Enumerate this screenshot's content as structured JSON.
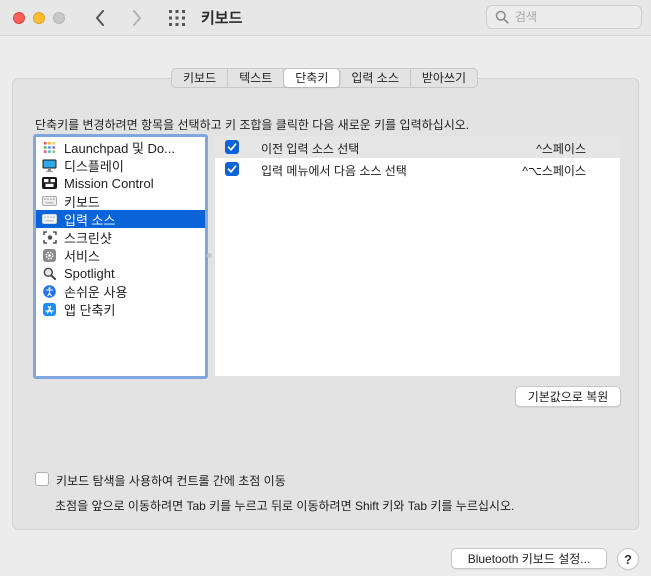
{
  "window": {
    "title": "키보드",
    "search_placeholder": "검색"
  },
  "tabs": [
    {
      "label": "키보드",
      "selected": false
    },
    {
      "label": "텍스트",
      "selected": false
    },
    {
      "label": "단축키",
      "selected": true
    },
    {
      "label": "입력 소스",
      "selected": false
    },
    {
      "label": "받아쓰기",
      "selected": false
    }
  ],
  "instructions": "단축키를 변경하려면 항목을 선택하고 키 조합을 클릭한 다음 새로운 키를 입력하십시오.",
  "categories": [
    {
      "label": "Launchpad 및 Do...",
      "icon": "launchpad-icon"
    },
    {
      "label": "디스플레이",
      "icon": "display-icon"
    },
    {
      "label": "Mission Control",
      "icon": "mission-control-icon"
    },
    {
      "label": "키보드",
      "icon": "keyboard-icon"
    },
    {
      "label": "입력 소스",
      "icon": "input-source-icon",
      "selected": true
    },
    {
      "label": "스크린샷",
      "icon": "screenshot-icon"
    },
    {
      "label": "서비스",
      "icon": "services-gear-icon"
    },
    {
      "label": "Spotlight",
      "icon": "spotlight-magnifier-icon"
    },
    {
      "label": "손쉬운 사용",
      "icon": "accessibility-icon"
    },
    {
      "label": "앱 단축키",
      "icon": "app-store-icon"
    }
  ],
  "shortcuts": [
    {
      "enabled": true,
      "label": "이전 입력 소스 선택",
      "keys": "^스페이스"
    },
    {
      "enabled": true,
      "label": "입력 메뉴에서 다음 소스 선택",
      "keys": "^⌥스페이스"
    }
  ],
  "buttons": {
    "restore_defaults": "기본값으로 복원",
    "bluetooth_settings": "Bluetooth 키보드 설정...",
    "help": "?"
  },
  "keyboard_navigation": {
    "checked": false,
    "label": "키보드 탐색을 사용하여 컨트롤 간에 초점 이동",
    "note": "초점을 앞으로 이동하려면 Tab 키를 누르고 뒤로 이동하려면 Shift 키와 Tab 키를 누르십시오."
  },
  "colors": {
    "accent": "#0a63d8",
    "close": "#fe5f57",
    "minimize": "#febc2e",
    "list_focus_ring": "#7ea7e0"
  }
}
